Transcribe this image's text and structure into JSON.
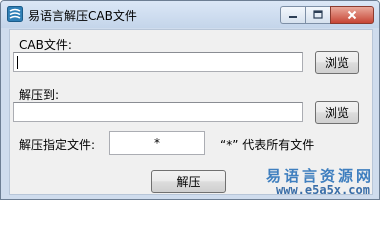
{
  "window": {
    "title": "易语言解压CAB文件"
  },
  "form": {
    "cab_label": "CAB文件:",
    "cab_value": "",
    "browse1_label": "浏览",
    "extract_to_label": "解压到:",
    "extract_to_value": "",
    "browse2_label": "浏览",
    "specify_label": "解压指定文件:",
    "specify_value": "*",
    "specify_hint": "“*” 代表所有文件",
    "extract_button": "解压"
  },
  "watermark": {
    "line1": "易语言资源网",
    "line2": "www.e5a5x.com"
  }
}
